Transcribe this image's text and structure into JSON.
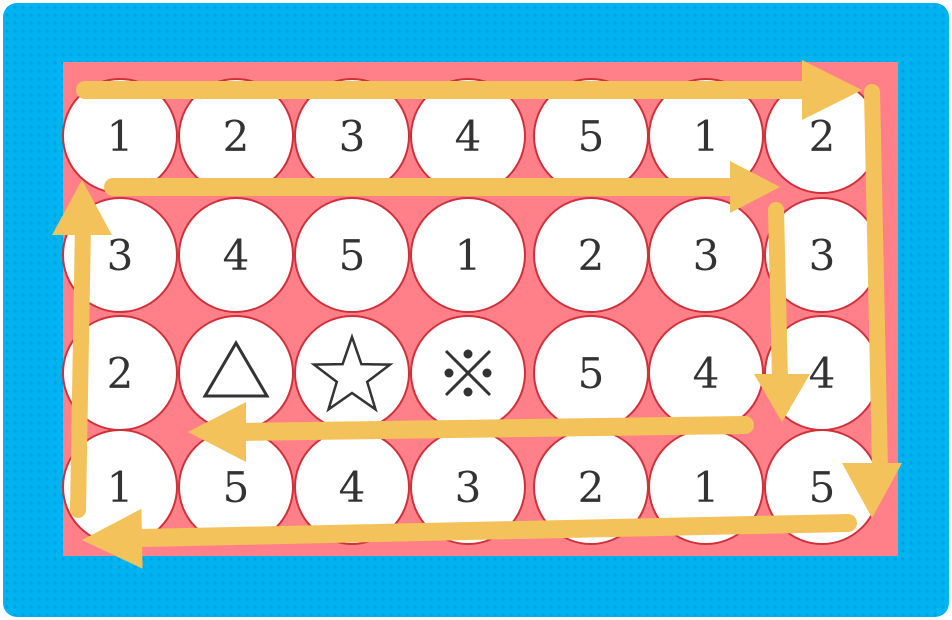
{
  "colors": {
    "frame": "#00b4f2",
    "board": "#ff8088",
    "cell_fill": "#ffffff",
    "cell_stroke": "#d0303a",
    "arrow": "#f3c25a",
    "text": "#333333"
  },
  "grid": {
    "rows": [
      [
        {
          "t": "1"
        },
        {
          "t": "2"
        },
        {
          "t": "3"
        },
        {
          "t": "4"
        },
        {
          "t": "5"
        },
        {
          "t": "1"
        },
        {
          "t": "2"
        }
      ],
      [
        {
          "t": "3"
        },
        {
          "t": "4"
        },
        {
          "t": "5"
        },
        {
          "t": "1"
        },
        {
          "t": "2"
        },
        {
          "t": "3"
        },
        {
          "t": "3"
        }
      ],
      [
        {
          "t": "2"
        },
        {
          "icon": "triangle-icon"
        },
        {
          "icon": "star-icon"
        },
        {
          "icon": "reference-mark-icon"
        },
        {
          "t": "5"
        },
        {
          "t": "4"
        },
        {
          "t": "4"
        }
      ],
      [
        {
          "t": "1"
        },
        {
          "t": "5"
        },
        {
          "t": "4"
        },
        {
          "t": "3"
        },
        {
          "t": "2"
        },
        {
          "t": "1"
        },
        {
          "t": "5"
        }
      ]
    ]
  }
}
